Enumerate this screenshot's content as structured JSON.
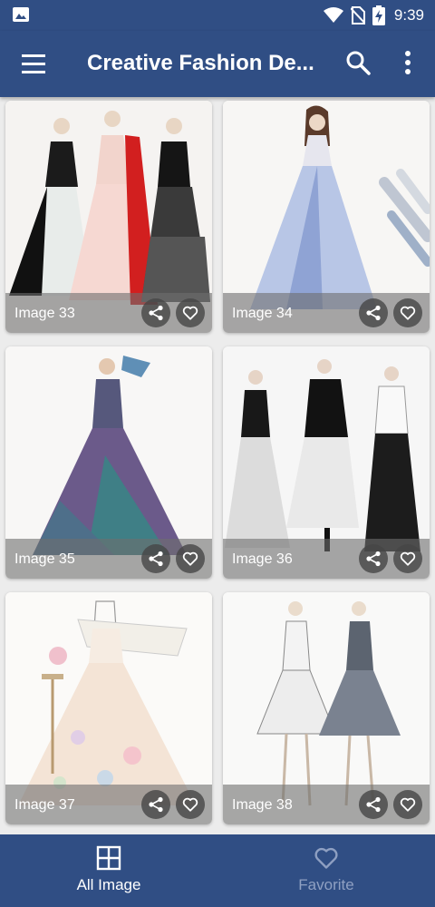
{
  "status_bar": {
    "time": "9:39",
    "icons": [
      "image-icon",
      "wifi-icon",
      "no-sim-icon",
      "battery-charging-icon"
    ]
  },
  "app_bar": {
    "title": "Creative Fashion De...",
    "icons": [
      "menu-icon",
      "search-icon",
      "more-vert-icon"
    ]
  },
  "images": [
    {
      "label": "Image 33"
    },
    {
      "label": "Image 34"
    },
    {
      "label": "Image 35"
    },
    {
      "label": "Image 36"
    },
    {
      "label": "Image 37"
    },
    {
      "label": "Image 38"
    }
  ],
  "bottom_nav": {
    "items": [
      {
        "label": "All Image",
        "icon": "grid-icon",
        "active": true
      },
      {
        "label": "Favorite",
        "icon": "heart-outline-icon",
        "active": false
      }
    ]
  },
  "colors": {
    "primary": "#304e84",
    "inactive_nav": "#8fa0c2",
    "background": "#ececec"
  }
}
